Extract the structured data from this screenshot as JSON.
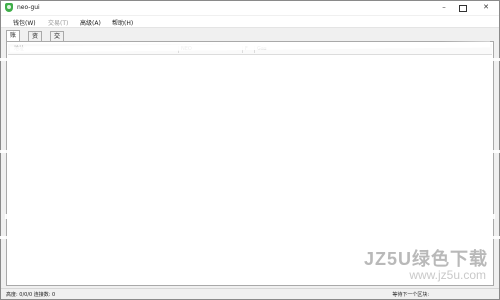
{
  "window": {
    "title": "neo-gui"
  },
  "menu": {
    "items": [
      {
        "label": "钱包(W)",
        "enabled": true
      },
      {
        "label": "交易(T)",
        "enabled": false
      },
      {
        "label": "高级(A)",
        "enabled": true
      },
      {
        "label": "帮助(H)",
        "enabled": true
      }
    ]
  },
  "tabs": [
    {
      "label": "账户",
      "active": true
    },
    {
      "label": "资产",
      "active": false
    },
    {
      "label": "交易记录",
      "active": false
    }
  ],
  "account_list": {
    "columns": [
      "地址",
      "NEO",
      "F",
      "Gas"
    ],
    "rows": []
  },
  "status": {
    "height_text": "高度: 0/0/0 连接数: 0",
    "next_block_text": "等待下一个区块:"
  },
  "watermark": {
    "brand": "JZ5U绿色下载",
    "url": "www.jz5u.com"
  }
}
